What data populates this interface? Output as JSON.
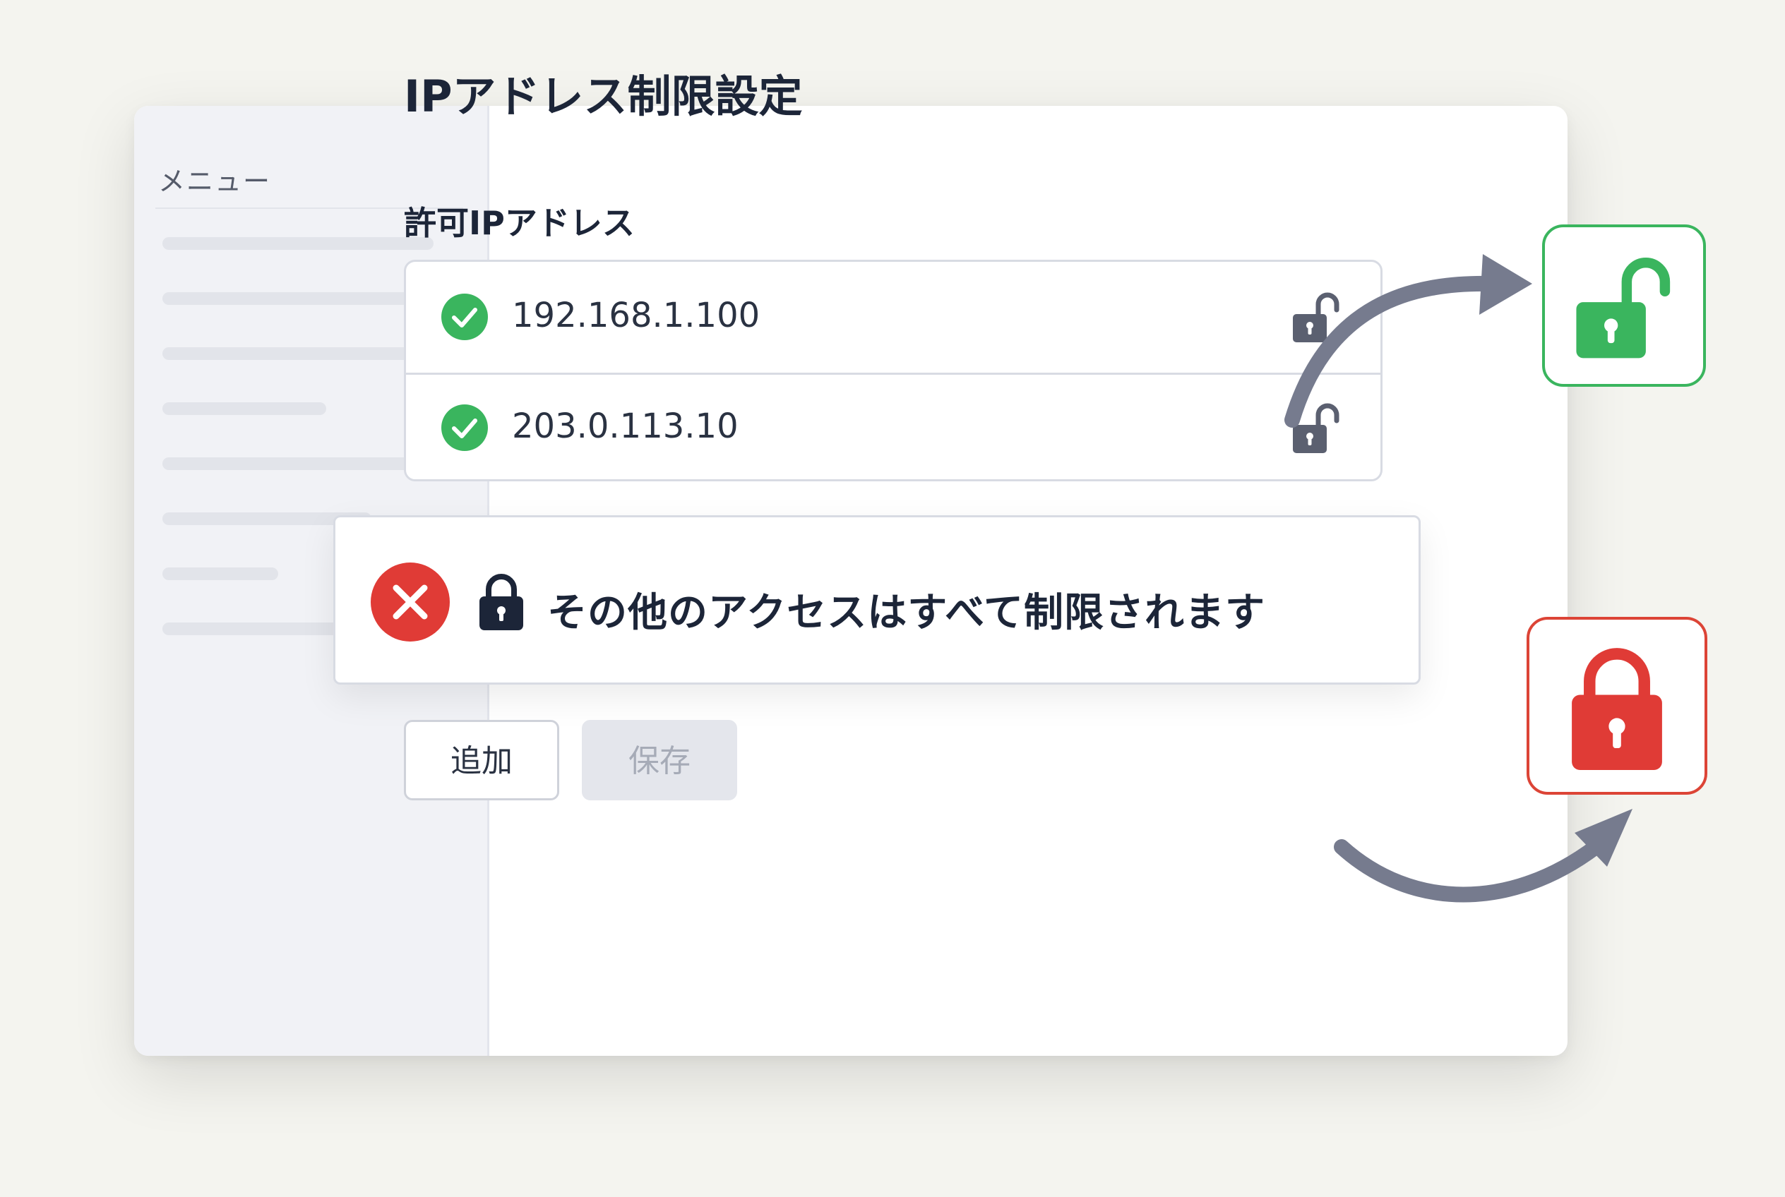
{
  "sidebar": {
    "title": "メニュー"
  },
  "main": {
    "title": "IPアドレス制限設定",
    "section_label": "許可IPアドレス",
    "allowed_ips": [
      "192.168.1.100",
      "203.0.113.10"
    ]
  },
  "banner": {
    "message": "その他のアクセスはすべて制限されます"
  },
  "buttons": {
    "add": "追加",
    "save": "保存"
  },
  "colors": {
    "allowed": "#3ab55e",
    "restricted": "#dc4436",
    "text": "#1c2538"
  },
  "icons": {
    "check": "check-circle-icon",
    "row_lock": "unlocked-padlock-icon",
    "error": "x-circle-icon",
    "banner_lock": "locked-padlock-icon",
    "green_badge": "unlocked-padlock-icon",
    "red_badge": "locked-padlock-icon"
  }
}
